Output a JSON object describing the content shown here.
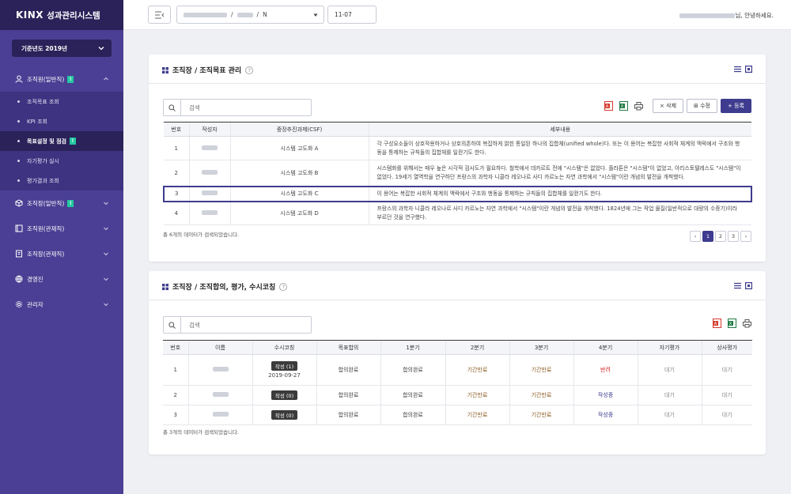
{
  "brand": {
    "logo": "KINX",
    "app_name": "성과관리시스템"
  },
  "sidebar": {
    "year_select": "기준년도 2019년",
    "menus": [
      {
        "label": "조직원(일반직)",
        "badge": "!",
        "expanded": true
      },
      {
        "label": "조직장(일반직)",
        "badge": "!"
      },
      {
        "label": "조직원(관제직)"
      },
      {
        "label": "조직장(관제직)"
      },
      {
        "label": "경영진"
      },
      {
        "label": "관리자"
      }
    ],
    "submenu": [
      {
        "label": "조직목표 조회"
      },
      {
        "label": "KPI 조회"
      },
      {
        "label": "목표설정 및 점검",
        "badge": "!",
        "active": true
      },
      {
        "label": "자기평가 실시"
      },
      {
        "label": "평가결과 조회"
      }
    ]
  },
  "header": {
    "selector": {
      "sep1": "/",
      "sep2": "/",
      "suffix": "N"
    },
    "date": "11-07",
    "greeting": "님, 안녕하세요."
  },
  "panel1": {
    "title": "조직장 / 조직목표 관리",
    "help": "?",
    "search_placeholder": "검색",
    "buttons": {
      "delete": "× 삭제",
      "edit": "⊞ 수정",
      "add": "+ 등록"
    },
    "columns": [
      "번호",
      "작성자",
      "중장추진과제(CSF)",
      "세부내용"
    ],
    "rows": [
      {
        "no": "1",
        "csf": "시스템 고도화 A",
        "detail": "각 구성요소들이 상호작용하거나 상호의존하여 복잡하게 얽힌 통일된 하나의 집합체(unified whole)다. 또는 이 용어는 복잡한 사회적 체계의 맥락에서 구조와 행동을 통제하는 규칙들의 집합체를 일컫기도 한다."
      },
      {
        "no": "2",
        "csf": "시스템 고도화 B",
        "detail": "시스템화를 위해서는 매우 높은 시각적 검사도가 필요하다. 철학에서 데카르트 전에 \"시스템\"은 없었다. 플라톤은 \"시스템\"이 없었고, 아리스토텔레스도 \"시스템\"이 없었다. 19세기 열역학을 연구하던 프랑스의 과학자 니콜라 레오나르 사디 카르노는 자연 과학에서 \"시스템\"이란 개념의 발전을 개척했다."
      },
      {
        "no": "3",
        "csf": "시스템 고도화 C",
        "detail": "이 용어는 복잡한 사회적 체계의 맥락에서 구조와 행동을 통제하는 규칙들의 집합체를 일컫기도 한다."
      },
      {
        "no": "4",
        "csf": "시스템 고도화 D",
        "detail": "프랑스의 과학자 니콜라 레오나르 사디 카르노는 자연 과학에서 \"시스템\"이란 개념의 발전을 개척했다. 1824년에 그는 작업 물질(일반적으로 대량의 수증기)이라 부르던 것을 연구했다."
      }
    ],
    "count_text": "총 6개의 데이터가 검색되었습니다.",
    "pagination": {
      "prev": "‹",
      "pages": [
        "1",
        "2",
        "3"
      ],
      "current": "1",
      "next": "›"
    }
  },
  "panel2": {
    "title": "조직장 / 조직합의, 평가, 수시코칭",
    "help": "?",
    "search_placeholder": "검색",
    "columns": [
      "번호",
      "이름",
      "수시코칭",
      "목표합의",
      "1분기",
      "2분기",
      "3분기",
      "4분기",
      "자기평가",
      "상사평가"
    ],
    "rows": [
      {
        "no": "1",
        "coaching": "작성 (1)",
        "coaching_date": "2019-09-27",
        "agree": "합의완료",
        "q1": "합의완료",
        "q2": "기간만료",
        "q3": "기간만료",
        "q4": "반려",
        "self": "대기",
        "boss": "대기"
      },
      {
        "no": "2",
        "coaching": "작성 (0)",
        "coaching_date": "",
        "agree": "합의완료",
        "q1": "합의완료",
        "q2": "기간만료",
        "q3": "기간만료",
        "q4": "작성중",
        "self": "대기",
        "boss": "대기"
      },
      {
        "no": "3",
        "coaching": "작성 (0)",
        "coaching_date": "",
        "agree": "합의완료",
        "q1": "합의완료",
        "q2": "기간만료",
        "q3": "기간만료",
        "q4": "작성중",
        "self": "대기",
        "boss": "대기"
      }
    ],
    "count_text": "총 3개의 데이터가 검색되었습니다."
  },
  "colors": {
    "sidebar": "#4a3f94",
    "sidebar_dark": "#2a2259",
    "accent": "#3e3c8e",
    "badge": "#24c7a0"
  }
}
